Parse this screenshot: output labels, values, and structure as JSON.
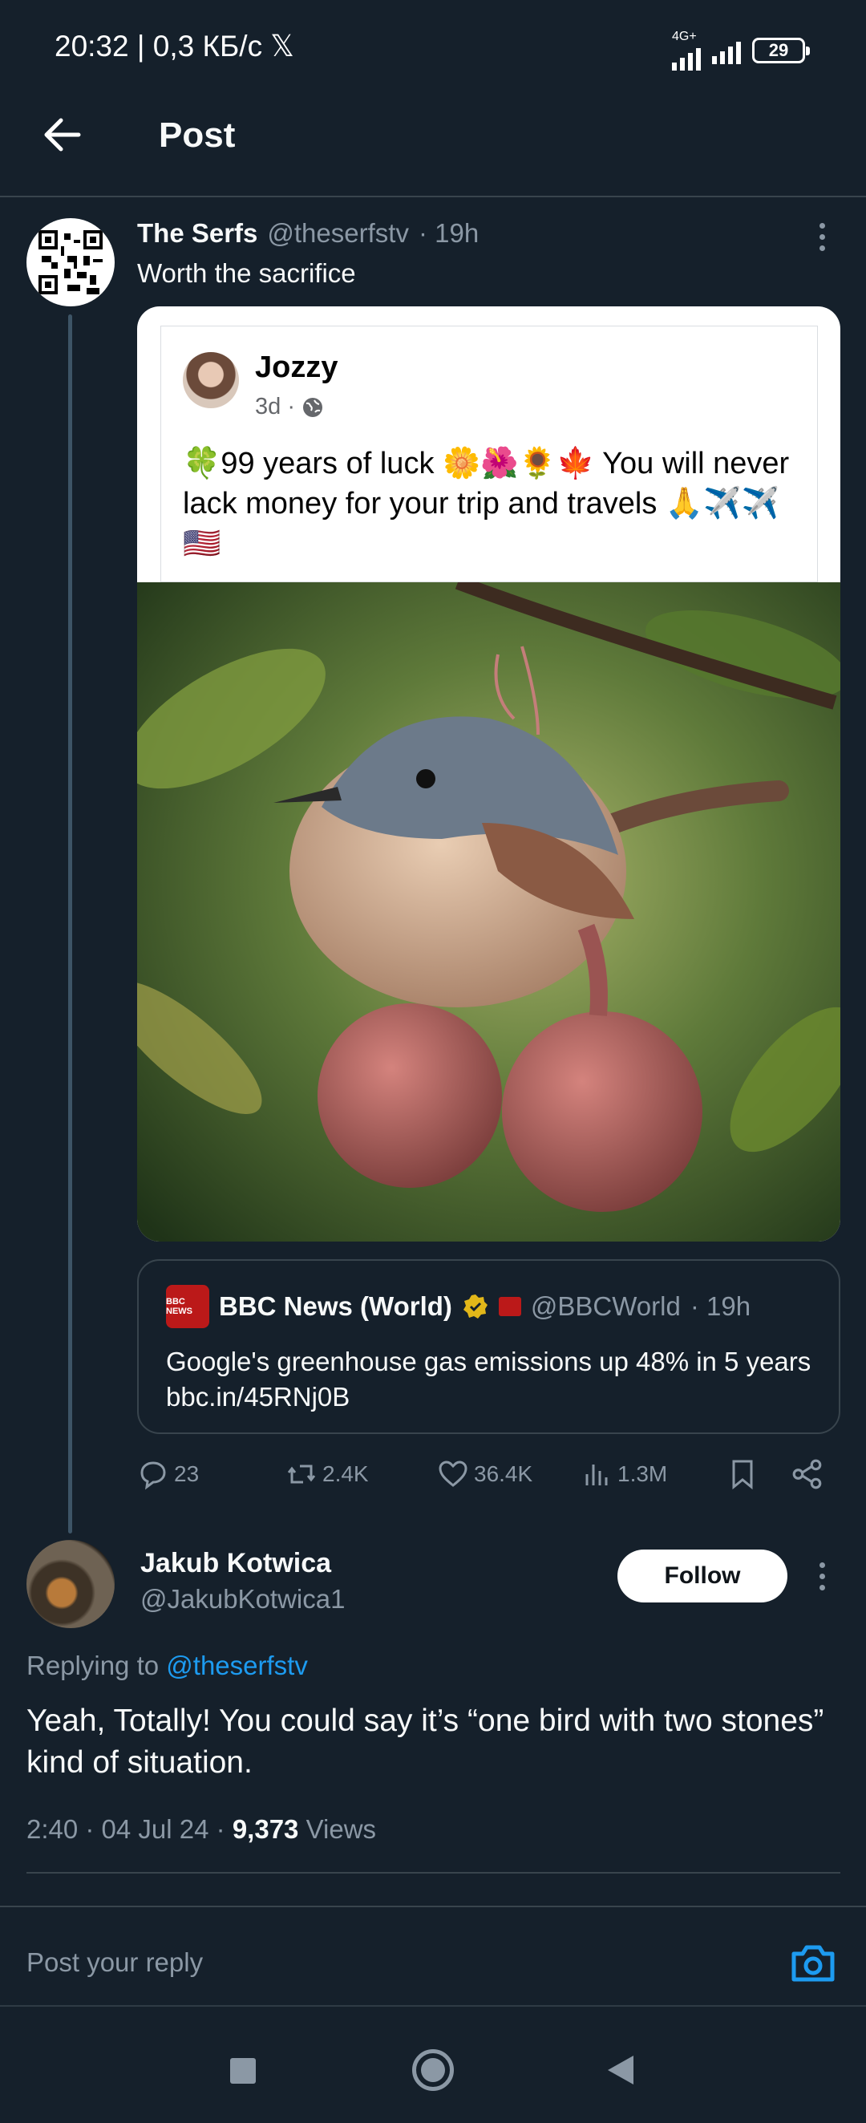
{
  "status_bar": {
    "time_speed": "20:32 | 0,3 КБ/с",
    "x_glyph": "𝕏",
    "network": "4G+",
    "battery": "29"
  },
  "header": {
    "title": "Post"
  },
  "main_tweet": {
    "author_name": "The Serfs",
    "handle": "@theserfstv",
    "time": "· 19h",
    "text": "Worth the sacrifice",
    "embedded_post": {
      "name": "Jozzy",
      "age": "3d ·",
      "text": "🍀99 years of luck 🌼🌺🌻🍁 You will never lack money for your trip and travels 🙏✈️✈️🇺🇸"
    },
    "quote": {
      "author_name": "BBC News (World)",
      "handle": "@BBCWorld",
      "time": "· 19h",
      "text": "Google's greenhouse gas emissions up 48% in 5 years",
      "link": "bbc.in/45RNj0B",
      "logo_text": "BBC NEWS"
    },
    "stats": {
      "replies": "23",
      "reposts": "2.4K",
      "likes": "36.4K",
      "views": "1.3M"
    }
  },
  "reply": {
    "author_name": "Jakub Kotwica",
    "handle": "@JakubKotwica1",
    "follow_label": "Follow",
    "replying_prefix": "Replying to",
    "replying_to": "@theserfstv",
    "text": "Yeah, Totally! You could say it’s “one bird with two stones” kind of situation.",
    "timestamp": "2:40 · 04 Jul 24 ·",
    "views_count": "9,373",
    "views_label": "Views"
  },
  "compose": {
    "placeholder": "Post your reply"
  },
  "colors": {
    "background": "#15202b",
    "accent": "#1d9bf0",
    "muted": "#8b98a5",
    "divider": "#38444d"
  },
  "icons": [
    "back-arrow-icon",
    "more-icon",
    "globe-icon",
    "verified-badge-icon",
    "reply-icon",
    "repost-icon",
    "like-icon",
    "views-icon",
    "bookmark-icon",
    "share-icon",
    "camera-icon",
    "qr-code-icon"
  ]
}
